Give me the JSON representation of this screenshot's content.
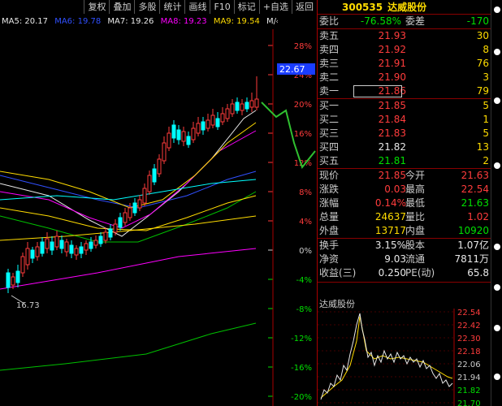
{
  "toolbar": {
    "buttons": [
      "复权",
      "叠加",
      "多股",
      "统计",
      "画线",
      "F10",
      "标记",
      "+自选",
      "返回"
    ]
  },
  "ma_legend": {
    "items": [
      {
        "text": "MA5: 20.17",
        "color": "#e8e8e8"
      },
      {
        "text": "MA6: 19.78",
        "color": "#3050ff"
      },
      {
        "text": "MA7: 19.26",
        "color": "#e8e8e8"
      },
      {
        "text": "MA8: 19.23",
        "color": "#ff00ff"
      },
      {
        "text": "MA9: 19.54",
        "color": "#ffdc00"
      },
      {
        "text": "M/◇",
        "color": "#e8e8e8"
      }
    ]
  },
  "chart": {
    "y_axis_labels": [
      "28%",
      "24%",
      "20%",
      "16%",
      "12%",
      "8%",
      "4%",
      "0%",
      "-4%",
      "-8%",
      "-12%",
      "-16%",
      "-20%"
    ],
    "price_tag": "22.67",
    "low_marker": "16.73"
  },
  "quote": {
    "code": "300535",
    "name": "达威股份",
    "ratio_label": "委比",
    "ratio_value": "-76.58%",
    "diff_label": "委差",
    "diff_value": "-170",
    "asks": [
      {
        "label": "卖五",
        "price": "21.93",
        "vol": "30"
      },
      {
        "label": "卖四",
        "price": "21.92",
        "vol": "8"
      },
      {
        "label": "卖三",
        "price": "21.91",
        "vol": "76"
      },
      {
        "label": "卖二",
        "price": "21.90",
        "vol": "3"
      },
      {
        "label": "卖一",
        "price": "21.86",
        "vol": "79"
      }
    ],
    "bids": [
      {
        "label": "买一",
        "price": "21.85",
        "vol": "5"
      },
      {
        "label": "买二",
        "price": "21.84",
        "vol": "1"
      },
      {
        "label": "买三",
        "price": "21.83",
        "vol": "5"
      },
      {
        "label": "买四",
        "price": "21.82",
        "vol": "13"
      },
      {
        "label": "买五",
        "price": "21.81",
        "vol": "2"
      }
    ],
    "stats": [
      {
        "l1": "现价",
        "v1": "21.85",
        "l2": "今开",
        "v2": "21.63"
      },
      {
        "l1": "涨跌",
        "v1": "0.03",
        "l2": "最高",
        "v2": "22.54"
      },
      {
        "l1": "涨幅",
        "v1": "0.14%",
        "l2": "最低",
        "v2": "21.63"
      },
      {
        "l1": "总量",
        "v1": "24637",
        "l2": "量比",
        "v2": "1.02"
      },
      {
        "l1": "外盘",
        "v1": "13717",
        "l2": "内盘",
        "v2": "10920"
      }
    ],
    "stats2": [
      {
        "l1": "换手",
        "v1": "3.15%",
        "l2": "股本",
        "v2": "1.07亿"
      },
      {
        "l1": "净资",
        "v1": "9.03",
        "l2": "流通",
        "v2": "7811万"
      },
      {
        "l1": "收益(三)",
        "v1": "0.250",
        "l2": "PE(动)",
        "v2": "65.8"
      }
    ]
  },
  "mini_chart": {
    "title": "达威股份",
    "price_labels": [
      "22.54",
      "22.42",
      "22.30",
      "22.18",
      "22.06",
      "21.94",
      "21.82",
      "21.70"
    ]
  },
  "colors": {
    "up": "#ff3c3c",
    "down": "#00e000",
    "accent": "#ffdc00",
    "annotation": "#30c030"
  }
}
